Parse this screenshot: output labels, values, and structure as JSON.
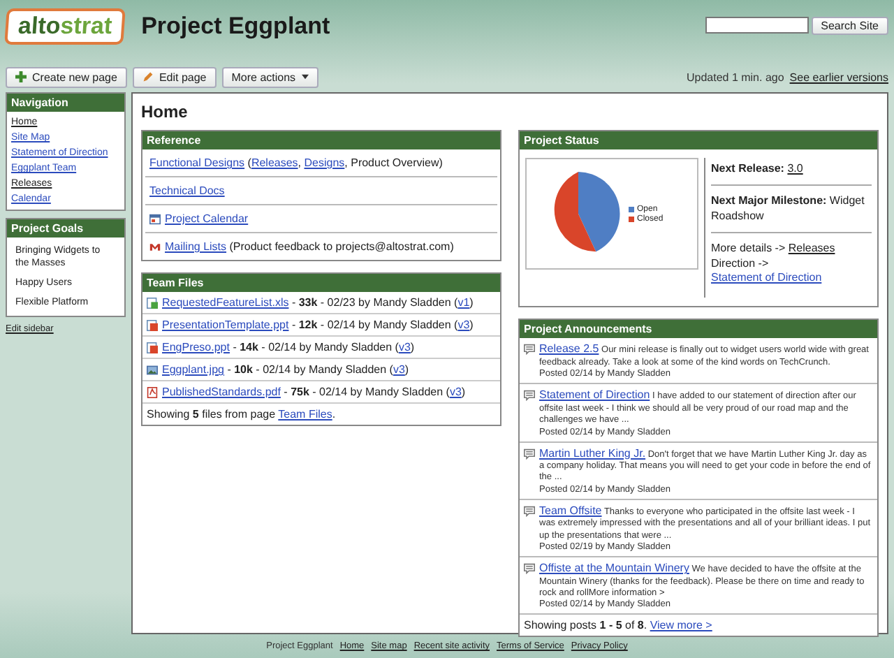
{
  "logo": {
    "part_1": "alto",
    "part_2": "strat"
  },
  "site_title": "Project Eggplant",
  "search": {
    "button": "Search Site"
  },
  "toolbar": {
    "buttons": [
      {
        "label": "Create new page",
        "kind": "create"
      },
      {
        "label": "Edit page",
        "kind": "edit"
      },
      {
        "label": "More actions",
        "kind": "menu"
      }
    ],
    "updated": "Updated 1 min. ago",
    "history_link": "See earlier versions"
  },
  "sidebar": {
    "navigation": {
      "title": "Navigation",
      "items": [
        {
          "label": "Home",
          "selected": true
        },
        {
          "label": "Site Map",
          "selected": false
        },
        {
          "label": "Statement of Direction",
          "selected": false
        },
        {
          "label": "Eggplant Team",
          "selected": false
        },
        {
          "label": "Releases",
          "selected": true
        },
        {
          "label": "Calendar",
          "selected": false
        }
      ]
    },
    "goals": {
      "title": "Project Goals",
      "items": [
        "Bringing Widgets to the Masses",
        "Happy Users",
        "Flexible Platform"
      ]
    },
    "edit_link": "Edit sidebar"
  },
  "page_title": "Home",
  "reference": {
    "title": "Reference",
    "rows": [
      {
        "kind": "plain",
        "parts": [
          {
            "text": "Functional Designs",
            "link": true
          },
          {
            "text": " (",
            "link": false
          },
          {
            "text": "Releases",
            "link": true
          },
          {
            "text": ", ",
            "link": false
          },
          {
            "text": "Designs",
            "link": true
          },
          {
            "text": ", Product Overview)",
            "link": false
          }
        ]
      },
      {
        "kind": "plain",
        "parts": [
          {
            "text": "Technical Docs",
            "link": true
          }
        ]
      },
      {
        "kind": "calendar",
        "parts": [
          {
            "text": "Project Calendar",
            "link": true
          }
        ]
      },
      {
        "kind": "mail",
        "parts": [
          {
            "text": "Mailing Lists",
            "link": true
          },
          {
            "text": "  (Product feedback to projects@altostrat.com)",
            "link": false
          }
        ]
      }
    ]
  },
  "team_files": {
    "title": "Team Files",
    "files": [
      {
        "kind": "sheet",
        "name": "RequestedFeatureList.xls",
        "detail": " - **33k** - 02/23 by Mandy Sladden (",
        "version": "v1",
        "end": ")"
      },
      {
        "kind": "slides",
        "name": "PresentationTemplate.ppt",
        "detail": " - **12k** - 02/14 by Mandy Sladden (",
        "version": "v3",
        "end": ")"
      },
      {
        "kind": "slides",
        "name": "EngPreso.ppt",
        "detail": " - **14k** - 02/14 by Mandy Sladden (",
        "version": "v3",
        "end": ")"
      },
      {
        "kind": "image",
        "name": "Eggplant.jpg",
        "detail": " - **10k** - 02/14 by Mandy Sladden (",
        "version": "v3",
        "end": ")"
      },
      {
        "kind": "pdf",
        "name": "PublishedStandards.pdf",
        "detail": " - **75k** - 02/14 by Mandy Sladden (",
        "version": "v3",
        "end": ")"
      }
    ],
    "footer": "Showing **5** files from page ",
    "footer_link": "Team Files",
    "footer_end": "."
  },
  "project_status": {
    "title": "Project Status",
    "legend": [
      {
        "label": "Open",
        "color": "#4f7ec4"
      },
      {
        "label": "Closed",
        "color": "#d9452a"
      }
    ],
    "next_release_label": "Next Release:",
    "next_release": "3.0",
    "milestone_label": "Next Major Milestone:",
    "milestone": " Widget Roadshow",
    "details": [
      {
        "text": "More details -> ",
        "link": "Releases"
      },
      {
        "text": "Direction -> ",
        "link": "Statement of Direction"
      }
    ]
  },
  "announcements": {
    "title": "Project Announcements",
    "posts": [
      {
        "title": "Release 2.5",
        "body": " Our mini release is finally out to widget users world wide with great feedback already. Take a look at some of the kind words on TechCrunch.",
        "posted": "Posted 02/14 by Mandy Sladden"
      },
      {
        "title": "Statement of Direction",
        "body": " I have added to our statement of direction after our offsite last week - I think we should all be very proud of our road map and the challenges we have ...",
        "posted": "Posted 02/14 by Mandy Sladden"
      },
      {
        "title": "Martin Luther King Jr.",
        "body": " Don't forget that we have Martin Luther King Jr. day as a company holiday. That means you will need to get your code in before the end of the ...",
        "posted": "Posted 02/14 by Mandy Sladden"
      },
      {
        "title": "Team Offsite",
        "body": " Thanks to everyone who participated in the offsite last week - I was extremely impressed with the presentations and all of your brilliant ideas. I put up the presentations that were ...",
        "posted": "Posted 02/19 by Mandy Sladden"
      },
      {
        "title": "Offiste at the Mountain Winery",
        "body": " We have decided to have the offsite at the Mountain Winery (thanks for the feedback). Please be there on time and ready to rock and rollMore information >",
        "posted": "Posted 02/14 by Mandy Sladden"
      }
    ],
    "footer": "Showing posts **1 - 5** of **8**. ",
    "footer_link": "View more >"
  },
  "footer": {
    "label": "Project Eggplant",
    "links": [
      "Home",
      "Site map",
      "Recent site activity",
      "Terms of Service",
      "Privacy Policy"
    ]
  }
}
